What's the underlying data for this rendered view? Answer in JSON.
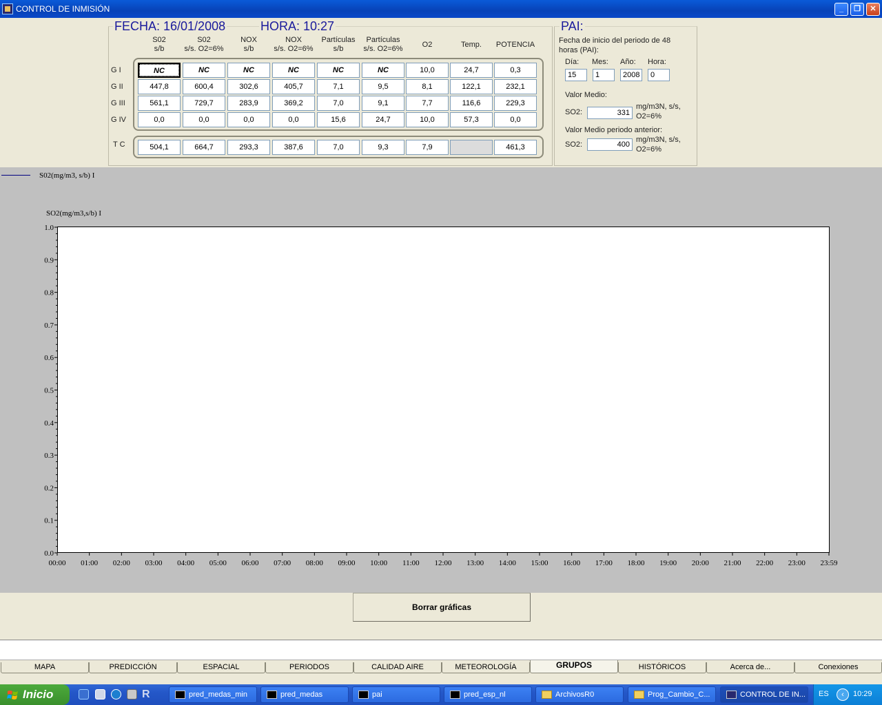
{
  "window": {
    "title": "CONTROL DE INMISIÓN"
  },
  "header": {
    "fecha": "FECHA: 16/01/2008",
    "hora": "HORA: 10:27"
  },
  "table": {
    "columns": [
      {
        "l1": "S02",
        "l2": "s/b"
      },
      {
        "l1": "S02",
        "l2": "s/s. O2=6%"
      },
      {
        "l1": "NOX",
        "l2": "s/b"
      },
      {
        "l1": "NOX",
        "l2": "s/s. O2=6%"
      },
      {
        "l1": "Partículas",
        "l2": "s/b"
      },
      {
        "l1": "Partículas",
        "l2": "s/s. O2=6%"
      },
      {
        "l1": "O2",
        "l2": ""
      },
      {
        "l1": "Temp.",
        "l2": ""
      },
      {
        "l1": "POTENCIA",
        "l2": ""
      }
    ],
    "rows": [
      {
        "label": "G I",
        "values": [
          "NC",
          "NC",
          "NC",
          "NC",
          "NC",
          "NC",
          "10,0",
          "24,7",
          "0,3"
        ]
      },
      {
        "label": "G II",
        "values": [
          "447,8",
          "600,4",
          "302,6",
          "405,7",
          "7,1",
          "9,5",
          "8,1",
          "122,1",
          "232,1"
        ]
      },
      {
        "label": "G III",
        "values": [
          "561,1",
          "729,7",
          "283,9",
          "369,2",
          "7,0",
          "9,1",
          "7,7",
          "116,6",
          "229,3"
        ]
      },
      {
        "label": "G IV",
        "values": [
          "0,0",
          "0,0",
          "0,0",
          "0,0",
          "15,6",
          "24,7",
          "10,0",
          "57,3",
          "0,0"
        ]
      }
    ],
    "total": {
      "label": "T C",
      "values": [
        "504,1",
        "664,7",
        "293,3",
        "387,6",
        "7,0",
        "9,3",
        "7,9",
        "",
        "461,3"
      ]
    }
  },
  "pai": {
    "title": "PAI:",
    "fecha_label": "Fecha de inicio del periodo de 48 horas  (PAI):",
    "dia_label": "Día:",
    "dia": "15",
    "mes_label": "Mes:",
    "mes": "1",
    "anio_label": "Año:",
    "anio": "2008",
    "hora_label": "Hora:",
    "hora": "0",
    "valor_medio_label": "Valor Medio:",
    "so2_label": "SO2:",
    "valor_medio": "331",
    "unit": "mg/m3N, s/s, O2=6%",
    "anterior_label": "Valor Medio periodo anterior:",
    "valor_anterior": "400"
  },
  "chart_data": {
    "type": "line",
    "legend": "S02(mg/m3, s/b) I",
    "ylabel": "SO2(mg/m3,s/b) I",
    "ylim": [
      0,
      1
    ],
    "yticks": [
      "0.0",
      "0.1",
      "0.2",
      "0.3",
      "0.4",
      "0.5",
      "0.6",
      "0.7",
      "0.8",
      "0.9",
      "1.0"
    ],
    "xticks": [
      "00:00",
      "01:00",
      "02:00",
      "03:00",
      "04:00",
      "05:00",
      "06:00",
      "07:00",
      "08:00",
      "09:00",
      "10:00",
      "11:00",
      "12:00",
      "13:00",
      "14:00",
      "15:00",
      "16:00",
      "17:00",
      "18:00",
      "19:00",
      "20:00",
      "21:00",
      "22:00",
      "23:00",
      "23:59"
    ],
    "series": [
      {
        "name": "S02(mg/m3, s/b) I",
        "values": [],
        "color": "#000080"
      }
    ]
  },
  "actions": {
    "borrar": "Borrar gráficas"
  },
  "tabs": [
    "MAPA",
    "PREDICCIÓN",
    "ESPACIAL",
    "PERIODOS",
    "CALIDAD AIRE",
    "METEOROLOGÍA",
    "GRUPOS",
    "HISTÓRICOS",
    "Acerca de...",
    "Conexiones"
  ],
  "active_tab": "GRUPOS",
  "taskbar": {
    "start": "Inicio",
    "items": [
      {
        "label": "pred_medas_min",
        "icon": "cmd"
      },
      {
        "label": "pred_medas",
        "icon": "cmd"
      },
      {
        "label": "pai",
        "icon": "cmd"
      },
      {
        "label": "pred_esp_nl",
        "icon": "cmd"
      },
      {
        "label": "ArchivosR0",
        "icon": "folder"
      },
      {
        "label": "Prog_Cambio_C...",
        "icon": "folder"
      },
      {
        "label": "CONTROL DE IN...",
        "icon": "app"
      }
    ],
    "lang": "ES",
    "clock": "10:29"
  }
}
